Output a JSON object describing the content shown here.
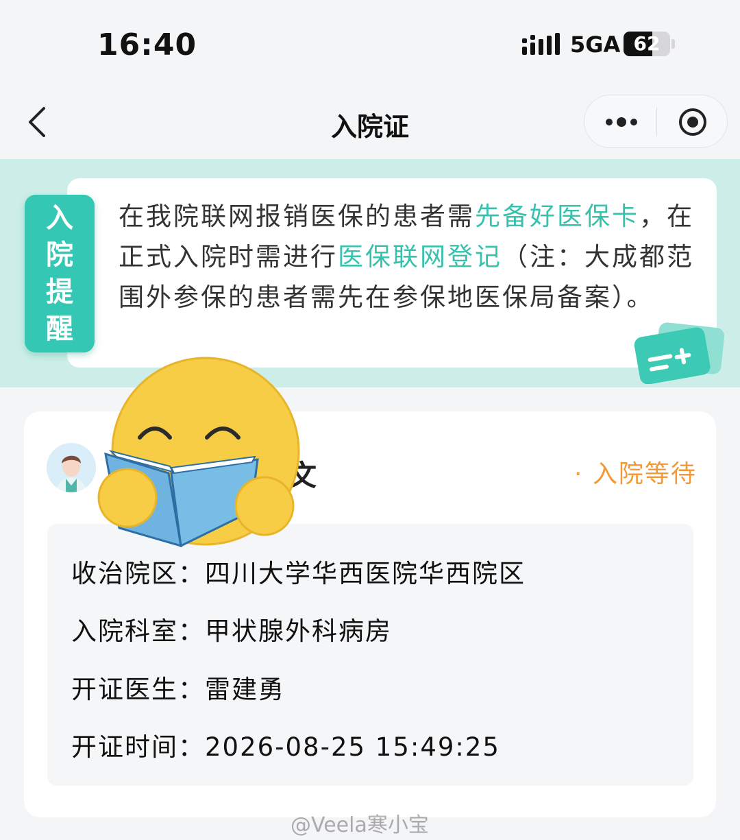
{
  "status_bar": {
    "time": "16:40",
    "network": "5GA",
    "battery": "62",
    "battery_level": 0.62
  },
  "nav": {
    "back_icon": "chevron-left-icon",
    "title": "入院证",
    "more_icon": "more-dots-icon",
    "close_icon": "target-circle-icon"
  },
  "banner": {
    "tag_chars": [
      "入",
      "院",
      "提",
      "醒"
    ],
    "text_1": "在我院联网报销医保的患者需",
    "highlight_1": "先备好医保卡",
    "text_2": "，在正式入院时需进行",
    "highlight_2": "医保联网登记",
    "text_3": "（注：大成都范围外参保的患者需先在参保地医保局备案）。",
    "accent_color": "#34c7b3"
  },
  "card": {
    "patient_name": "文",
    "status": "· 入院等待",
    "status_color": "#f29a38",
    "rows": [
      {
        "label": "收治院区：",
        "value": "四川大学华西医院华西院区"
      },
      {
        "label": "入院科室：",
        "value": "甲状腺外科病房"
      },
      {
        "label": "开证医生：",
        "value": "雷建勇"
      },
      {
        "label": "开证时间：",
        "value": "2026-08-25 15:49:25"
      }
    ]
  },
  "watermark": "@Veela寒小宝"
}
